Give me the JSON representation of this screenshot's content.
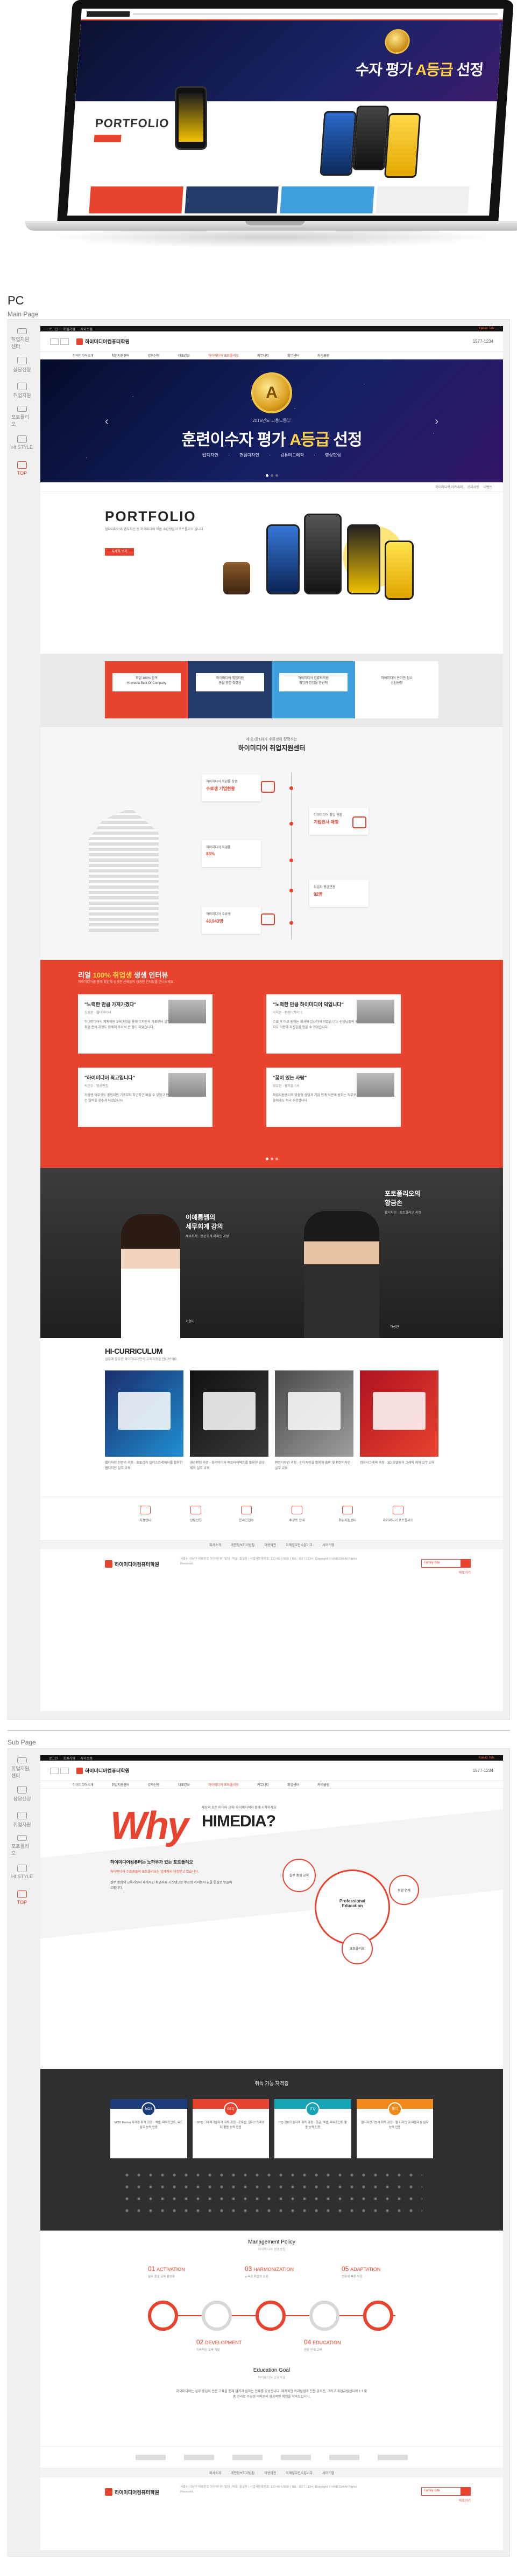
{
  "hero": {
    "banner_title_prefix": "수자 평가 ",
    "banner_title_em": "A등급",
    "banner_title_suffix": " 선정",
    "portfolio": "PORTFOLIO"
  },
  "labels": {
    "pc": "PC",
    "main_page": "Main Page",
    "sub_page": "Sub Page"
  },
  "quick_rail": [
    {
      "label": "취업지원센터",
      "red": false
    },
    {
      "label": "상담신청",
      "red": false
    },
    {
      "label": "취업지원",
      "red": false
    },
    {
      "label": "포트폴리오",
      "red": false
    },
    {
      "label": "HI STYLE",
      "red": false
    },
    {
      "label": "TOP",
      "red": true
    }
  ],
  "site": {
    "util_links": [
      "로그인",
      "회원가입",
      "사이트맵"
    ],
    "util_right": "Kakao Talk",
    "logo": "하이미디어컴퓨터학원",
    "tel": "1577-1234",
    "gnb": [
      "하이미디어소개",
      "취업지원센터",
      "강의신청",
      "대표강좌",
      "하이미디어 포트폴리오",
      "커뮤니티",
      "취업센터",
      "커리큘럼"
    ],
    "gnb_active": 4
  },
  "main_banner": {
    "medal": "A",
    "small": "2016년도 고용노동부",
    "title_prefix": "훈련이수자 평가 ",
    "title_em": "A등급",
    "title_suffix": " 선정",
    "subs": "웹디자인 · 편집디자인 · 컴퓨터그래픽 · 영상편집",
    "prev": "‹",
    "next": "›",
    "foot": [
      "하이미디어 아카데미",
      "공지사항",
      "이벤트"
    ]
  },
  "portfolio": {
    "title": "PORTFOLIO",
    "desc": "멀티미디어와 웹디자인 등 하이미디어 학원 수강생들의 포트폴리오 입니다.",
    "button": "자세히 보기"
  },
  "quick_banners": [
    {
      "color": "red",
      "text1": "취업 100% 합격",
      "text2": "Hi-media Best Of Company"
    },
    {
      "color": "navy",
      "text1": "하이미디어 취업지원",
      "text2": "꿈을 향한 첫걸음"
    },
    {
      "color": "blue",
      "text1": "하이미디어 컴퓨터학원",
      "text2": "취업과 창업을 한번에"
    },
    {
      "color": "white",
      "text1": "하이미디어 온라인 접수",
      "text2": "상담신청"
    }
  ],
  "center": {
    "small": "세대1를1위가 수료생이 증명하는",
    "title": "하이미디어 취업지원센터",
    "cards": [
      {
        "label": "하이미디어 취업률 상승",
        "value": "수료생 기업현황"
      },
      {
        "label": "하이미디어 취업 현황",
        "value": "기업인사 매칭"
      },
      {
        "label": "하이미디어 취업률",
        "value": "83%"
      },
      {
        "label": "취업자 평균연봉",
        "value": "92명"
      },
      {
        "label": "하이미디어 수료생",
        "value": "48,943명"
      }
    ]
  },
  "success": {
    "title_prefix": "리얼 ",
    "title_em": "100% 취업생",
    "title_suffix": " 생생 인터뷰",
    "sub": "하이미디어를 통해 취업에 성공한 선배들의 생생한 인터뷰를 만나보세요.",
    "cards": [
      {
        "q": "\"노력한 만큼 가져가겠다\"",
        "who": "김성훈 - 웹디자이너",
        "txt": "하이미디어의 체계적인 교육과정을 통해 디자인의 기초부터 실무까지 배울 수 있었습니다. 취업 준비 과정도 함께해 주셔서 큰 힘이 되었습니다."
      },
      {
        "q": "\"노력한 만큼 하이미디어 덕입니다\"",
        "who": "이지은 - 편집디자이너",
        "txt": "수료 후 바로 원하는 회사에 입사하게 되었습니다. 선생님들의 꼼꼼한 피드백과 포트폴리오 지도 덕분에 자신감을 얻을 수 있었습니다."
      },
      {
        "q": "\"하이미디어 최고입니다\"",
        "who": "박민수 - 영상편집",
        "txt": "처음엔 아무것도 몰랐지만 기초부터 차근차근 배울 수 있었고 현업에서도 바로 활용할 수 있는 실력을 갖추게 되었습니다."
      },
      {
        "q": "\"꿈이 있는 사람\"",
        "who": "최유진 - 웹퍼블리셔",
        "txt": "취업지원센터의 맞춤형 상담과 기업 연계 덕분에 원하는 직무로 취업할 수 있었습니다. 후배들에게도 적극 추천합니다."
      }
    ]
  },
  "teachers": [
    {
      "line1": "이예름쌤의",
      "line2": "세무회계 강의",
      "desc": "세무회계 · 전산회계 자격증 과정",
      "name": "서현아"
    },
    {
      "line1": "포토폴리오의",
      "line2": "황금손",
      "desc": "웹디자인 · 포트폴리오 과정",
      "name": "이성현"
    }
  ],
  "curriculum": {
    "title": "HI-CURRICULUM",
    "sub": "실무에 필요한 하이미디어만의 교육과정을 만나보세요.",
    "captions": [
      "웹디자인 전문가 과정 - 포토샵과 일러스트레이터를 활용한 웹디자인 실무 교육",
      "영상편집 과정 - 프리미어와 애프터이펙트를 활용한 영상 제작 실무 교육",
      "편집디자인 과정 - 인디자인을 활용한 출판 및 편집디자인 실무 교육",
      "컴퓨터그래픽 과정 - 3D 모델링과 그래픽 제작 실무 교육"
    ]
  },
  "quick_icons": [
    "지점안내",
    "상담신청",
    "온라인접수",
    "수강료 안내",
    "취업지원센터",
    "하이미디어 포트폴리오"
  ],
  "footer": {
    "nav": [
      "회사소개",
      "개인정보처리방침",
      "이용약관",
      "이메일무단수집거부",
      "사이트맵"
    ],
    "logo": "하이미디어컴퓨터학원",
    "addr": "서울시 강남구 테헤란로 하이미디어 빌딩 | 대표: 홍길동 | 사업자등록번호: 123-45-67890 | TEL: 1577-1234 | Copyright © HIMEDIA All Rights Reserved.",
    "family": "Family Site",
    "go": "바로가기"
  },
  "sub": {
    "why": "Why",
    "why_sub": "세상의 모든 미디어 교육! 하이미디어와 함께 시작하세요",
    "himedia": "HIMEDIA?",
    "body_title": "하이미디어컴퓨터는 노하우가 있는 포트폴리오",
    "body_red": "하이미디어 수료생들의 포트폴리오는 업계에서 인정받고 있습니다.",
    "body": "실무 중심의 교육과정과 체계적인 취업지원 시스템으로 수강생 여러분의 꿈을 현실로 만들어 드립니다.",
    "circle_main": "Professional Education",
    "circle_1": "실무 중심 교육",
    "circle_2": "취업 연계",
    "circle_3": "포트폴리오",
    "jobs_title": "취득 가능 자격증",
    "jobs": [
      {
        "tag": "MOS",
        "text": "MOS Master 자격증 취득 과정 - 엑셀, 파워포인트, 워드 실무 능력 인증"
      },
      {
        "tag": "GTQ",
        "text": "GTQ 그래픽기술자격 취득 과정 - 포토샵, 일러스트레이터 활용 능력 인증"
      },
      {
        "tag": "ITQ",
        "text": "ITQ 정보기술자격 취득 과정 - 한글, 엑셀, 파워포인트 활용 능력 인증"
      },
      {
        "tag": "웹디",
        "text": "웹디자인기능사 취득 과정 - 웹 디자인 및 퍼블리싱 실무 능력 인증"
      }
    ],
    "policy_title": "Management Policy",
    "policy_sub": "하이미디어 경영방침",
    "steps": [
      {
        "num": "01",
        "name": "ACTIVATION",
        "desc": "실무 중심 교육 활성화"
      },
      {
        "num": "03",
        "name": "HARMONIZATION",
        "desc": "교육과 취업의 조화"
      },
      {
        "num": "05",
        "name": "ADAPTATION",
        "desc": "변화에 빠른 적응"
      },
      {
        "num": "02",
        "name": "DEVELOPMENT",
        "desc": "지속적인 교육 개발"
      },
      {
        "num": "04",
        "name": "EDUCATION",
        "desc": "전문 인재 교육"
      }
    ],
    "goal_title": "Education Goal",
    "goal_sub": "하이미디어 교육목표",
    "goal_text": "하이미디어는 실무 중심의 전문 교육을 통해 업계가 원하는 인재를 양성합니다. 체계적인 커리큘럼과 전문 강사진, 그리고 취업지원센터의 1:1 맞춤 관리로 수강생 여러분의 성공적인 취업을 약속드립니다."
  }
}
